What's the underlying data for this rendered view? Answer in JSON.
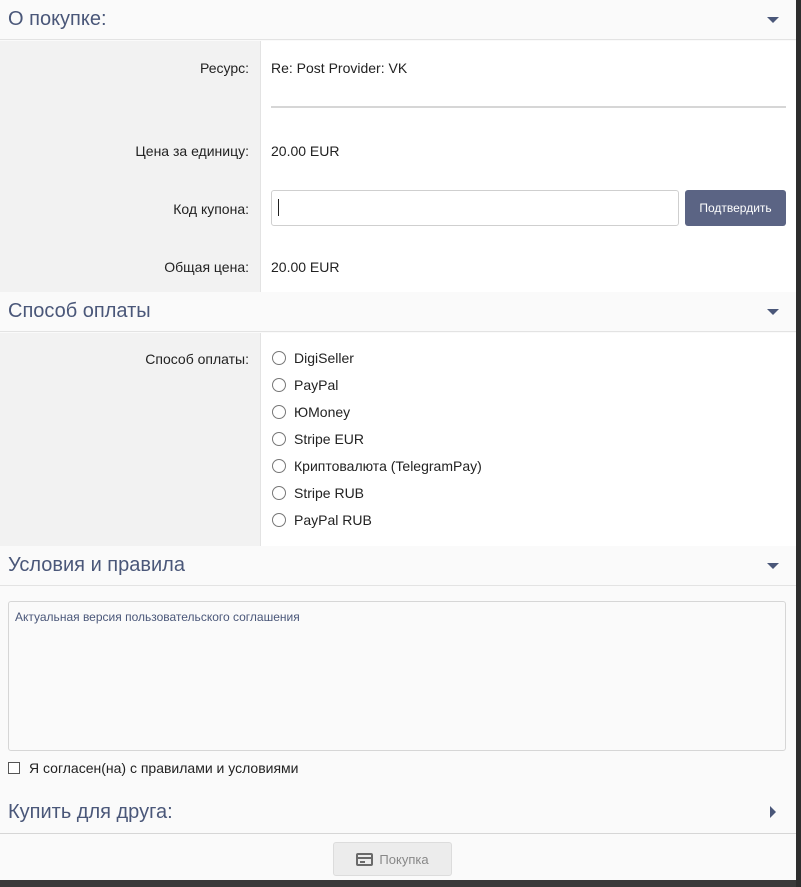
{
  "purchase": {
    "header": "О покупке:",
    "resource_label": "Ресурс:",
    "resource_value": "Re: Post Provider: VK",
    "unit_price_label": "Цена за единицу:",
    "unit_price_value": "20.00 EUR",
    "coupon_label": "Код купона:",
    "coupon_value": "",
    "confirm_label": "Подтвердить",
    "total_label": "Общая цена:",
    "total_value": "20.00 EUR"
  },
  "payment": {
    "header": "Способ оплаты",
    "label": "Способ оплаты:",
    "options": [
      "DigiSeller",
      "PayPal",
      "ЮMoney",
      "Stripe EUR",
      "Криптовалюта (TelegramPay)",
      "Stripe RUB",
      "PayPal RUB"
    ]
  },
  "terms": {
    "header": "Условия и правила",
    "text": "Актуальная версия пользовательского соглашения",
    "agree_label": "Я согласен(на) с правилами и условиями"
  },
  "gift": {
    "header": "Купить для друга:"
  },
  "footer": {
    "buy_label": "Покупка"
  }
}
